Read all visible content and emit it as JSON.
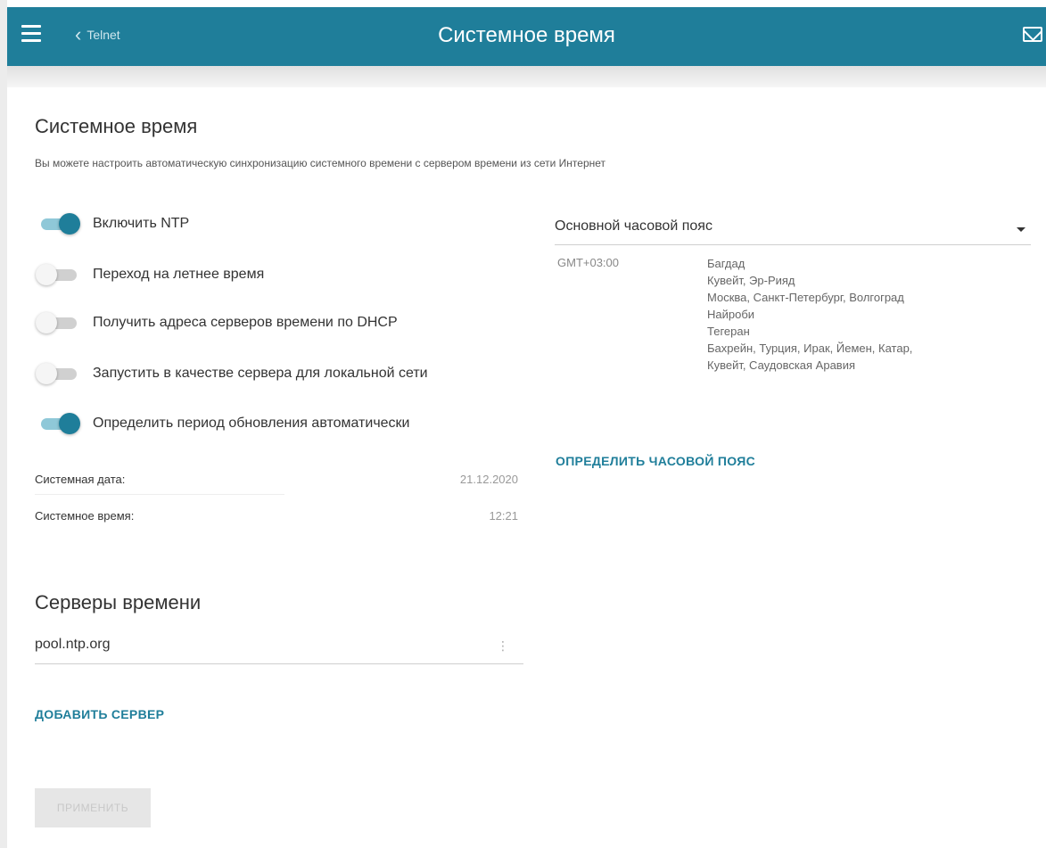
{
  "header": {
    "title": "Системное время",
    "back_label": "Telnet",
    "accent_color": "#1f7e9a"
  },
  "system_time_section": {
    "title": "Системное время",
    "description": "Вы можете настроить автоматическую синхронизацию системного времени с сервером времени из сети Интернет",
    "toggles": [
      {
        "label": "Включить NTP",
        "state": "on"
      },
      {
        "label": "Переход на летнее время",
        "state": "off"
      },
      {
        "label": "Получить адреса серверов времени по DHCP",
        "state": "off"
      },
      {
        "label": "Запустить в качестве сервера для локальной сети",
        "state": "off"
      },
      {
        "label": "Определить период обновления автоматически",
        "state": "on"
      }
    ],
    "date_label": "Системная дата:",
    "date_value": "21.12.2020",
    "time_label": "Системное время:",
    "time_value": "12:21"
  },
  "servers_section": {
    "title": "Серверы времени",
    "servers": [
      {
        "value": "pool.ntp.org"
      }
    ],
    "add_label": "ДОБАВИТЬ СЕРВЕР"
  },
  "timezone": {
    "select_value": "Основной часовой пояс",
    "offset": "GMT+03:00",
    "cities": [
      "Багдад",
      "Кувейт, Эр-Рияд",
      "Москва, Санкт-Петербург, Волгоград",
      "Найроби",
      "Тегеран",
      "Бахрейн, Турция, Ирак, Йемен, Катар,",
      "Кувейт, Саудовская Аравия"
    ],
    "detect_label": "ОПРЕДЕЛИТЬ ЧАСОВОЙ ПОЯС"
  },
  "apply_label": "ПРИМЕНИТЬ",
  "icons": {
    "menu": "menu-icon",
    "back": "chevron-left-icon",
    "mail": "mail-icon",
    "dropdown": "chevron-down-icon",
    "more": "more-vert-icon"
  }
}
